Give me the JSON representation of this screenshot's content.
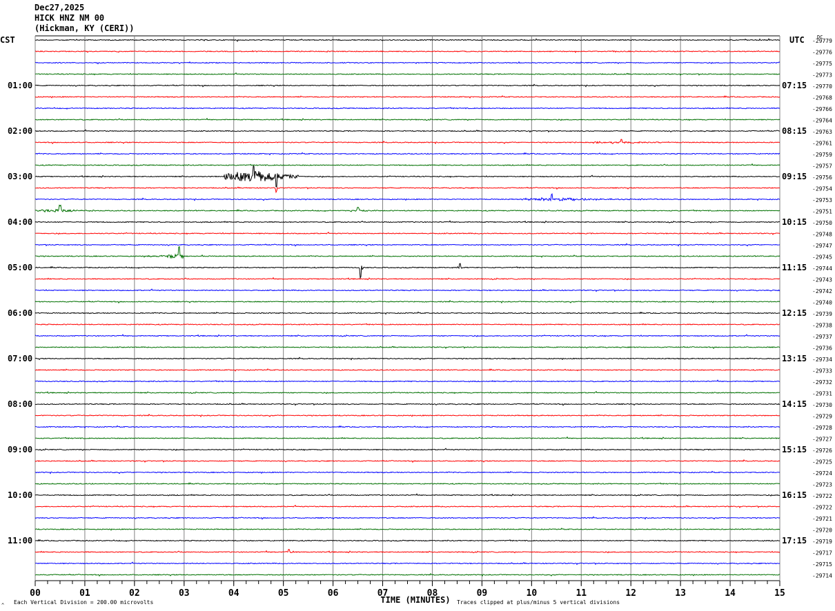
{
  "header": {
    "date": "Dec27,2025",
    "station": "HICK HNZ NM 00",
    "location": "(Hickman, KY (CERI))"
  },
  "chart_data": {
    "type": "line",
    "title": "HICK HNZ NM 00 helicorder",
    "xlabel": "TIME (MINUTES)",
    "xlim": [
      0,
      15
    ],
    "x_ticks": [
      "00",
      "01",
      "02",
      "03",
      "04",
      "05",
      "06",
      "07",
      "08",
      "09",
      "10",
      "11",
      "12",
      "13",
      "14",
      "15"
    ],
    "left_timezone": "CST",
    "right_timezone": "UTC",
    "dc_label": "DC",
    "left_hour_labels": [
      "CST",
      "01:00",
      "02:00",
      "03:00",
      "04:00",
      "05:00",
      "06:00",
      "07:00",
      "08:00",
      "09:00",
      "10:00",
      "11:00"
    ],
    "right_hour_labels": [
      "UTC",
      "07:15",
      "08:15",
      "09:15",
      "10:15",
      "11:15",
      "12:15",
      "13:15",
      "14:15",
      "15:15",
      "16:15",
      "17:15"
    ],
    "dc_offsets": [
      "-29779",
      "-29776",
      "-29775",
      "-29773",
      "-29770",
      "-29768",
      "-29766",
      "-29764",
      "-29763",
      "-29761",
      "-29759",
      "-29757",
      "-29756",
      "-29754",
      "-29753",
      "-29751",
      "-29750",
      "-29748",
      "-29747",
      "-29745",
      "-29744",
      "-29743",
      "-29742",
      "-29740",
      "-29739",
      "-29738",
      "-29737",
      "-29736",
      "-29734",
      "-29733",
      "-29732",
      "-29731",
      "-29730",
      "-29729",
      "-29728",
      "-29727",
      "-29726",
      "-29725",
      "-29724",
      "-29723",
      "-29722",
      "-29722",
      "-29721",
      "-29720",
      "-29719",
      "-29717",
      "-29715",
      "-29714"
    ],
    "trace_colors": [
      "#000000",
      "#ff0000",
      "#0000ff",
      "#007000"
    ],
    "grid_color": "#808080",
    "events": [
      {
        "row": 12,
        "start_min": 3.8,
        "end_min": 5.3,
        "peak_min": 4.4,
        "amplitude_div": 2.0
      },
      {
        "row": 12,
        "start_min": 4.8,
        "end_min": 4.9,
        "peak_min": 4.85,
        "amplitude_div": -1.6
      },
      {
        "row": 13,
        "start_min": 4.8,
        "end_min": 4.9,
        "peak_min": 4.85,
        "amplitude_div": -0.4
      },
      {
        "row": 14,
        "start_min": 9.8,
        "end_min": 12.5,
        "peak_min": 10.4,
        "amplitude_div": 0.5
      },
      {
        "row": 15,
        "start_min": 0.0,
        "end_min": 1.2,
        "peak_min": 0.5,
        "amplitude_div": 0.5
      },
      {
        "row": 15,
        "start_min": 6.3,
        "end_min": 6.9,
        "peak_min": 6.5,
        "amplitude_div": 0.3
      },
      {
        "row": 19,
        "start_min": 2.2,
        "end_min": 3.0,
        "peak_min": 2.9,
        "amplitude_div": 0.8
      },
      {
        "row": 20,
        "start_min": 6.5,
        "end_min": 6.6,
        "peak_min": 6.55,
        "amplitude_div": -1.0
      },
      {
        "row": 20,
        "start_min": 8.5,
        "end_min": 8.6,
        "peak_min": 8.55,
        "amplitude_div": 0.3
      },
      {
        "row": 9,
        "start_min": 10.8,
        "end_min": 12.8,
        "peak_min": 11.8,
        "amplitude_div": 0.3
      },
      {
        "row": 45,
        "start_min": 4.8,
        "end_min": 5.3,
        "peak_min": 5.1,
        "amplitude_div": 0.3
      }
    ]
  },
  "footer": {
    "scale_note": "Each Vertical Division =  200.00 microvolts",
    "clip_note": "Traces clipped at plus/minus 5 vertical divisions",
    "corner_mark": "^"
  }
}
